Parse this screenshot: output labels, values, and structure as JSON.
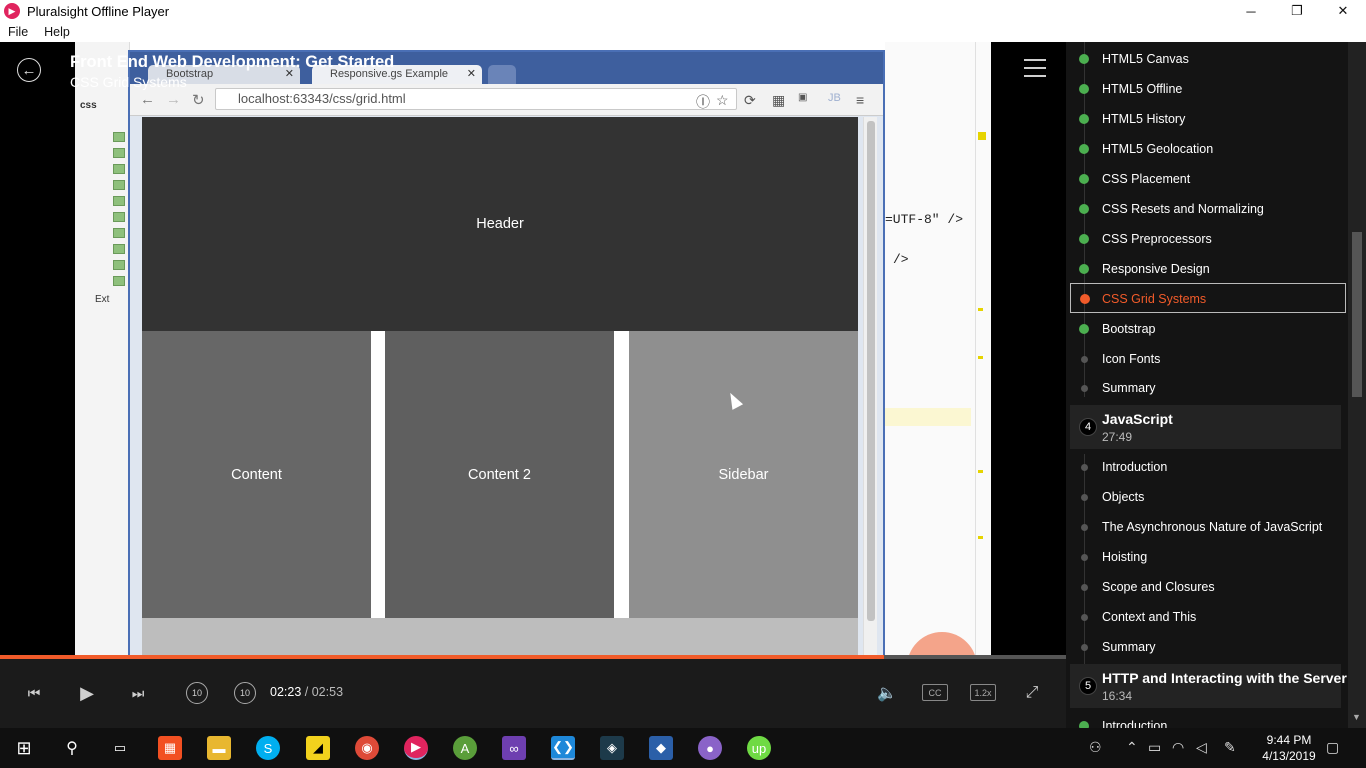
{
  "window": {
    "title": "Pluralsight Offline Player",
    "minimize": "─",
    "maximize": "❐",
    "close": "✕"
  },
  "menu": {
    "file": "File",
    "help": "Help"
  },
  "player": {
    "course_title": "Front End Web Development: Get Started",
    "clip_title": "CSS Grid Systems",
    "current_time": "02:23",
    "separator": "/",
    "duration": "02:53",
    "progress": 0.829,
    "speed": "1.2x",
    "cc": "CC",
    "rewind_label": "10",
    "forward_label": "10"
  },
  "video": {
    "browser_tabs": [
      {
        "label": "Bootstrap"
      },
      {
        "label": "Responsive.gs Example"
      }
    ],
    "url": "localhost:63343/css/grid.html",
    "page": {
      "header": "Header",
      "content": "Content",
      "content2": "Content 2",
      "sidebar": "Sidebar"
    },
    "ide_left_labels": [
      "css",
      "Ext"
    ],
    "code_lines": [
      "=UTF-8\" />",
      "/>"
    ]
  },
  "sidebar": {
    "clips_before": [
      {
        "label": "HTML5 Canvas",
        "status": "done"
      },
      {
        "label": "HTML5 Offline",
        "status": "done"
      },
      {
        "label": "HTML5 History",
        "status": "done"
      },
      {
        "label": "HTML5 Geolocation",
        "status": "done"
      },
      {
        "label": "CSS Placement",
        "status": "done"
      },
      {
        "label": "CSS Resets and Normalizing",
        "status": "done"
      },
      {
        "label": "CSS Preprocessors",
        "status": "done"
      },
      {
        "label": "Responsive Design",
        "status": "done"
      },
      {
        "label": "CSS Grid Systems",
        "status": "current"
      },
      {
        "label": "Bootstrap",
        "status": "done"
      },
      {
        "label": "Icon Fonts",
        "status": "todo"
      },
      {
        "label": "Summary",
        "status": "todo"
      }
    ],
    "module4": {
      "number": "4",
      "title": "JavaScript",
      "duration": "27:49",
      "clips": [
        {
          "label": "Introduction"
        },
        {
          "label": "Objects"
        },
        {
          "label": "The Asynchronous Nature of JavaScript"
        },
        {
          "label": "Hoisting"
        },
        {
          "label": "Scope and Closures"
        },
        {
          "label": "Context and This"
        },
        {
          "label": "Summary"
        }
      ]
    },
    "module5": {
      "number": "5",
      "title": "HTTP and Interacting with the Server",
      "duration": "16:34",
      "first_clip": "Introduction"
    }
  },
  "taskbar": {
    "time": "9:44 PM",
    "date": "4/13/2019"
  },
  "colors": {
    "accent": "#f15b2a",
    "done": "#4caf50",
    "header_box": "#333333",
    "content_box": "#676767",
    "content2_box": "#5f5f5f",
    "sidebar_box": "#8f8f8f",
    "footer_box": "#bdbdbd"
  }
}
